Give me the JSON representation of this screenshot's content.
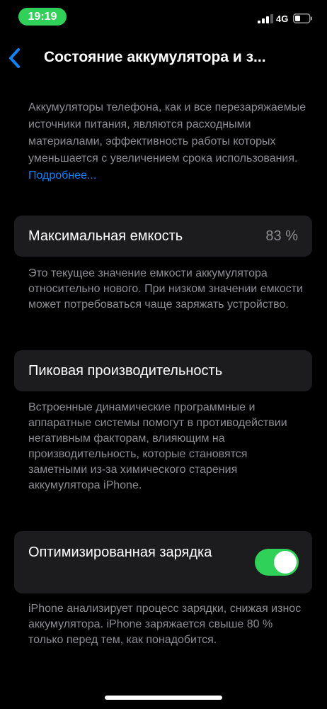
{
  "status_bar": {
    "time": "19:19",
    "network": "4G",
    "accent_color": "#30d158",
    "icons": [
      "signal-icon",
      "battery-icon"
    ]
  },
  "nav": {
    "back_icon": "chevron-left-icon",
    "title": "Состояние аккумулятора и з..."
  },
  "intro": {
    "text": "Аккумуляторы телефона, как и все перезаряжаемые источники питания, являются расходными материалами, эффективность работы которых умень­шается с увеличением срока использо­вания.",
    "link": "Подробнее..."
  },
  "max_capacity": {
    "label": "Максимальная емкость",
    "value": "83 %",
    "footnote": "Это текущее значение емкости аккумулятора относительно нового. При низком значении емкости может потребоваться чаще заряжать устройство."
  },
  "peak_performance": {
    "label": "Пиковая производительность",
    "footnote": "Встроенные динамические программные и аппаратные системы помогут в противодействии негативным факторам, влияющим на производительность, которые становятся заметными из-за химического старения аккумулятора iPhone."
  },
  "optimized_charging": {
    "label": "Оптимизированная зарядка",
    "enabled": true,
    "footnote": "iPhone анализирует процесс зарядки, снижая износ аккумулятора. iPhone заряжается свыше 80 % только перед тем, как понадобится."
  },
  "colors": {
    "background": "#000000",
    "cell": "#1c1c1e",
    "secondary_text": "#8d8d93",
    "link": "#0a84ff",
    "toggle_on": "#30d158"
  }
}
